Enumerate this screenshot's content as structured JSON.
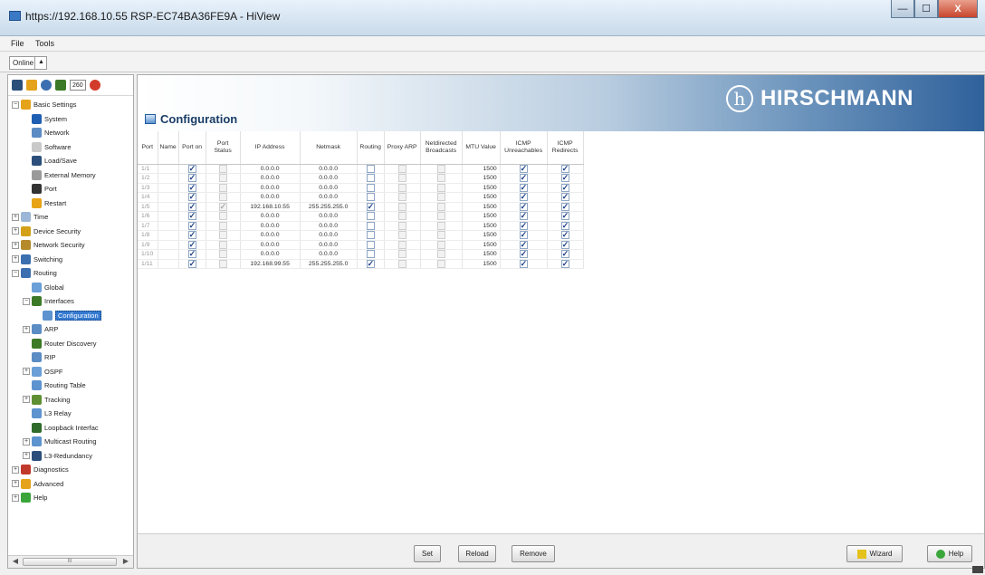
{
  "window": {
    "title": "https://192.168.10.55 RSP-EC74BA36FE9A - HiView",
    "controls": [
      "—",
      "☐",
      "X"
    ]
  },
  "menu": [
    "File",
    "Tools"
  ],
  "toolbar": {
    "mode": "Online",
    "mode_dropdown": "▲",
    "counter": "260"
  },
  "tree": [
    {
      "label": "Basic Settings",
      "level": 0,
      "exp": "−",
      "icon": "star-icon",
      "color": "#e5a21b"
    },
    {
      "label": "System",
      "level": 1,
      "icon": "info-icon",
      "color": "#1e5fb3"
    },
    {
      "label": "Network",
      "level": 1,
      "icon": "network-icon",
      "color": "#5b8cc4"
    },
    {
      "label": "Software",
      "level": 1,
      "icon": "software-icon",
      "color": "#c9c9c9"
    },
    {
      "label": "Load/Save",
      "level": 1,
      "icon": "disk-icon",
      "color": "#2b4f7a"
    },
    {
      "label": "External Memory",
      "level": 1,
      "icon": "memory-icon",
      "color": "#9a9a9a"
    },
    {
      "label": "Port",
      "level": 1,
      "icon": "port-icon",
      "color": "#333333"
    },
    {
      "label": "Restart",
      "level": 1,
      "icon": "restart-icon",
      "color": "#e8a317"
    },
    {
      "label": "Time",
      "level": 0,
      "exp": "+",
      "icon": "clock-icon",
      "color": "#9bb6d6"
    },
    {
      "label": "Device Security",
      "level": 0,
      "exp": "+",
      "icon": "lock-icon",
      "color": "#d4a017"
    },
    {
      "label": "Network Security",
      "level": 0,
      "exp": "+",
      "icon": "shield-icon",
      "color": "#b58a2a"
    },
    {
      "label": "Switching",
      "level": 0,
      "exp": "+",
      "icon": "switch-icon",
      "color": "#3b6fb0"
    },
    {
      "label": "Routing",
      "level": 0,
      "exp": "−",
      "icon": "router-icon",
      "color": "#3b6fb0"
    },
    {
      "label": "Global",
      "level": 1,
      "icon": "global-icon",
      "color": "#6a9fd8"
    },
    {
      "label": "Interfaces",
      "level": 1,
      "exp": "−",
      "icon": "interfaces-icon",
      "color": "#3d7a28"
    },
    {
      "label": "Configuration",
      "level": 2,
      "icon": "config-icon",
      "color": "#5d93cf",
      "selected": true
    },
    {
      "label": "ARP",
      "level": 1,
      "exp": "+",
      "icon": "arp-icon",
      "color": "#5b8cc4"
    },
    {
      "label": "Router Discovery",
      "level": 1,
      "icon": "discovery-icon",
      "color": "#3d7a28"
    },
    {
      "label": "RIP",
      "level": 1,
      "icon": "rip-icon",
      "color": "#5b8cc4"
    },
    {
      "label": "OSPF",
      "level": 1,
      "exp": "+",
      "icon": "ospf-icon",
      "color": "#6a9fd8"
    },
    {
      "label": "Routing Table",
      "level": 1,
      "icon": "table-icon",
      "color": "#5d93cf"
    },
    {
      "label": "Tracking",
      "level": 1,
      "exp": "+",
      "icon": "tracking-icon",
      "color": "#5e8f32"
    },
    {
      "label": "L3 Relay",
      "level": 1,
      "icon": "relay-icon",
      "color": "#5d93cf"
    },
    {
      "label": "Loopback Interfac",
      "level": 1,
      "icon": "loopback-icon",
      "color": "#2f6b2a"
    },
    {
      "label": "Multicast Routing",
      "level": 1,
      "exp": "+",
      "icon": "multicast-icon",
      "color": "#5d93cf"
    },
    {
      "label": "L3-Redundancy",
      "level": 1,
      "exp": "+",
      "icon": "redundancy-icon",
      "color": "#2b4f7a"
    },
    {
      "label": "Diagnostics",
      "level": 0,
      "exp": "+",
      "icon": "diagnostics-icon",
      "color": "#c0392b"
    },
    {
      "label": "Advanced",
      "level": 0,
      "exp": "+",
      "icon": "star-icon",
      "color": "#e5a21b"
    },
    {
      "label": "Help",
      "level": 0,
      "exp": "+",
      "icon": "help-icon",
      "color": "#3aa63a"
    }
  ],
  "scroll": {
    "left": "◀",
    "right": "▶",
    "grip": "III"
  },
  "main": {
    "title": "Configuration",
    "brand": "HIRSCHMANN",
    "brand_logo": "h",
    "columns": [
      "Port",
      "Name",
      "Port on",
      "Port Status",
      "IP Address",
      "Netmask",
      "Routing",
      "Proxy ARP",
      "Netdirected Broadcasts",
      "MTU Value",
      "ICMP Unreachables",
      "ICMP Redirects"
    ],
    "rows": [
      {
        "port": "1/1",
        "name": "",
        "port_on": true,
        "port_status": false,
        "ip": "0.0.0.0",
        "netmask": "0.0.0.0",
        "routing": false,
        "proxy_arp": false,
        "netdirected": false,
        "mtu": "1500",
        "icmp_unreach": true,
        "icmp_redirects": true
      },
      {
        "port": "1/2",
        "name": "",
        "port_on": true,
        "port_status": false,
        "ip": "0.0.0.0",
        "netmask": "0.0.0.0",
        "routing": false,
        "proxy_arp": false,
        "netdirected": false,
        "mtu": "1500",
        "icmp_unreach": true,
        "icmp_redirects": true
      },
      {
        "port": "1/3",
        "name": "",
        "port_on": true,
        "port_status": false,
        "ip": "0.0.0.0",
        "netmask": "0.0.0.0",
        "routing": false,
        "proxy_arp": false,
        "netdirected": false,
        "mtu": "1500",
        "icmp_unreach": true,
        "icmp_redirects": true
      },
      {
        "port": "1/4",
        "name": "",
        "port_on": true,
        "port_status": false,
        "ip": "0.0.0.0",
        "netmask": "0.0.0.0",
        "routing": false,
        "proxy_arp": false,
        "netdirected": false,
        "mtu": "1500",
        "icmp_unreach": true,
        "icmp_redirects": true
      },
      {
        "port": "1/5",
        "name": "",
        "port_on": true,
        "port_status": true,
        "ip": "192.168.10.55",
        "netmask": "255.255.255.0",
        "routing": true,
        "proxy_arp": false,
        "netdirected": false,
        "mtu": "1500",
        "icmp_unreach": true,
        "icmp_redirects": true
      },
      {
        "port": "1/6",
        "name": "",
        "port_on": true,
        "port_status": false,
        "ip": "0.0.0.0",
        "netmask": "0.0.0.0",
        "routing": false,
        "proxy_arp": false,
        "netdirected": false,
        "mtu": "1500",
        "icmp_unreach": true,
        "icmp_redirects": true
      },
      {
        "port": "1/7",
        "name": "",
        "port_on": true,
        "port_status": false,
        "ip": "0.0.0.0",
        "netmask": "0.0.0.0",
        "routing": false,
        "proxy_arp": false,
        "netdirected": false,
        "mtu": "1500",
        "icmp_unreach": true,
        "icmp_redirects": true
      },
      {
        "port": "1/8",
        "name": "",
        "port_on": true,
        "port_status": false,
        "ip": "0.0.0.0",
        "netmask": "0.0.0.0",
        "routing": false,
        "proxy_arp": false,
        "netdirected": false,
        "mtu": "1500",
        "icmp_unreach": true,
        "icmp_redirects": true
      },
      {
        "port": "1/9",
        "name": "",
        "port_on": true,
        "port_status": false,
        "ip": "0.0.0.0",
        "netmask": "0.0.0.0",
        "routing": false,
        "proxy_arp": false,
        "netdirected": false,
        "mtu": "1500",
        "icmp_unreach": true,
        "icmp_redirects": true
      },
      {
        "port": "1/10",
        "name": "",
        "port_on": true,
        "port_status": false,
        "ip": "0.0.0.0",
        "netmask": "0.0.0.0",
        "routing": false,
        "proxy_arp": false,
        "netdirected": false,
        "mtu": "1500",
        "icmp_unreach": true,
        "icmp_redirects": true
      },
      {
        "port": "1/11",
        "name": "",
        "port_on": true,
        "port_status": false,
        "ip": "192.168.99.55",
        "netmask": "255.255.255.0",
        "routing": true,
        "proxy_arp": false,
        "netdirected": false,
        "mtu": "1500",
        "icmp_unreach": true,
        "icmp_redirects": true
      }
    ]
  },
  "buttons": {
    "set": "Set",
    "reload": "Reload",
    "remove": "Remove",
    "wizard": "Wizard",
    "help": "Help"
  },
  "colors": {
    "banner_dark": "#2f619b",
    "selection": "#3379d0",
    "check": "#1d3f87"
  }
}
